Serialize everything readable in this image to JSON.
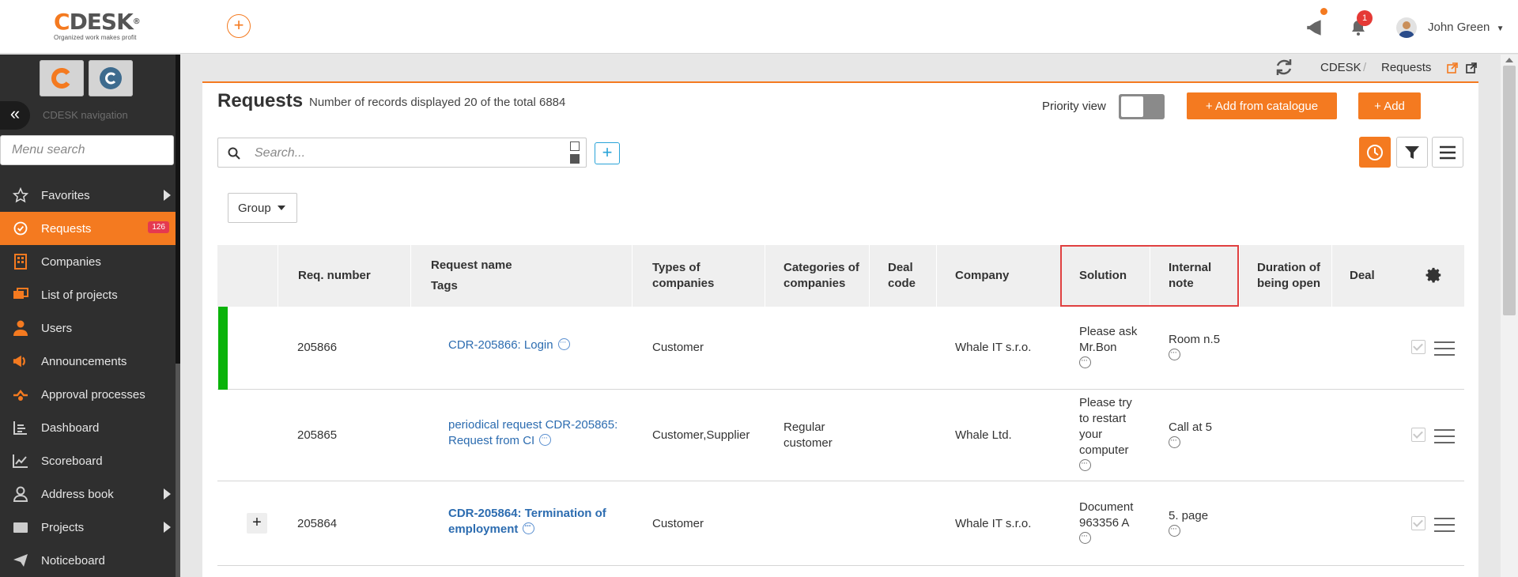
{
  "app": {
    "logo_text": "CDESK",
    "logo_tagline": "Organized work makes profit",
    "notification_count": "1",
    "user_name": "John Green"
  },
  "sidebar": {
    "nav_caption": "CDESK navigation",
    "menu_search_placeholder": "Menu search",
    "items": [
      {
        "label": "Favorites",
        "icon": "star-icon",
        "has_submenu": true
      },
      {
        "label": "Requests",
        "icon": "requests-icon",
        "badge": "126",
        "active": true
      },
      {
        "label": "Companies",
        "icon": "companies-icon"
      },
      {
        "label": "List of projects",
        "icon": "projects-list-icon"
      },
      {
        "label": "Users",
        "icon": "user-icon"
      },
      {
        "label": "Announcements",
        "icon": "megaphone-icon"
      },
      {
        "label": "Approval processes",
        "icon": "approval-icon"
      },
      {
        "label": "Dashboard",
        "icon": "dashboard-icon"
      },
      {
        "label": "Scoreboard",
        "icon": "chart-line-icon"
      },
      {
        "label": "Address book",
        "icon": "address-book-icon",
        "has_submenu": true
      },
      {
        "label": "Projects",
        "icon": "folder-icon",
        "has_submenu": true
      },
      {
        "label": "Noticeboard",
        "icon": "paper-plane-icon"
      }
    ]
  },
  "breadcrumb": {
    "items": [
      "CDESK",
      "Requests"
    ]
  },
  "page": {
    "title": "Requests",
    "records_info": "Number of records displayed 20 of the total 6884",
    "priority_view_label": "Priority view",
    "priority_view_on": false,
    "add_from_catalogue_label": "+ Add from catalogue",
    "add_label": "+ Add",
    "search_placeholder": "Search...",
    "group_label": "Group"
  },
  "table": {
    "columns": [
      {
        "key": "req_number",
        "label": "Req. number"
      },
      {
        "key": "request_name",
        "label": "Request name",
        "sub_label": "Tags"
      },
      {
        "key": "types_of_companies",
        "label": "Types of companies"
      },
      {
        "key": "categories_of_companies",
        "label": "Categories of companies"
      },
      {
        "key": "deal_code",
        "label": "Deal code"
      },
      {
        "key": "company",
        "label": "Company"
      },
      {
        "key": "solution",
        "label": "Solution"
      },
      {
        "key": "internal_note",
        "label": "Internal note"
      },
      {
        "key": "duration_open",
        "label": "Duration of being open"
      },
      {
        "key": "deal",
        "label": "Deal"
      }
    ],
    "highlighted_columns": [
      "Solution",
      "Internal note"
    ],
    "rows": [
      {
        "req_number": "205866",
        "request_name": "CDR-205866: Login",
        "types_of_companies": "Customer",
        "categories_of_companies": "",
        "company": "Whale IT s.r.o.",
        "solution": "Please ask Mr.Bon",
        "internal_note": "Room n.5",
        "priority_color": "#0ab30a"
      },
      {
        "req_number": "205865",
        "request_name": "periodical request CDR-205865: Request from CI",
        "types_of_companies": "Customer,Supplier",
        "categories_of_companies": "Regular customer",
        "company": "Whale Ltd.",
        "solution": "Please try to restart your computer",
        "internal_note": "Call at 5"
      },
      {
        "req_number": "205864",
        "request_name": "CDR-205864: Termination of employment",
        "types_of_companies": "Customer",
        "categories_of_companies": "",
        "company": "Whale IT s.r.o.",
        "solution": "Document 963356 A",
        "internal_note": "5. page",
        "expandable": true
      }
    ]
  },
  "colors": {
    "accent": "#f47a20",
    "sidebar_bg": "#2f2f2f",
    "link": "#2c6cb0",
    "highlight_border": "#e04040"
  }
}
